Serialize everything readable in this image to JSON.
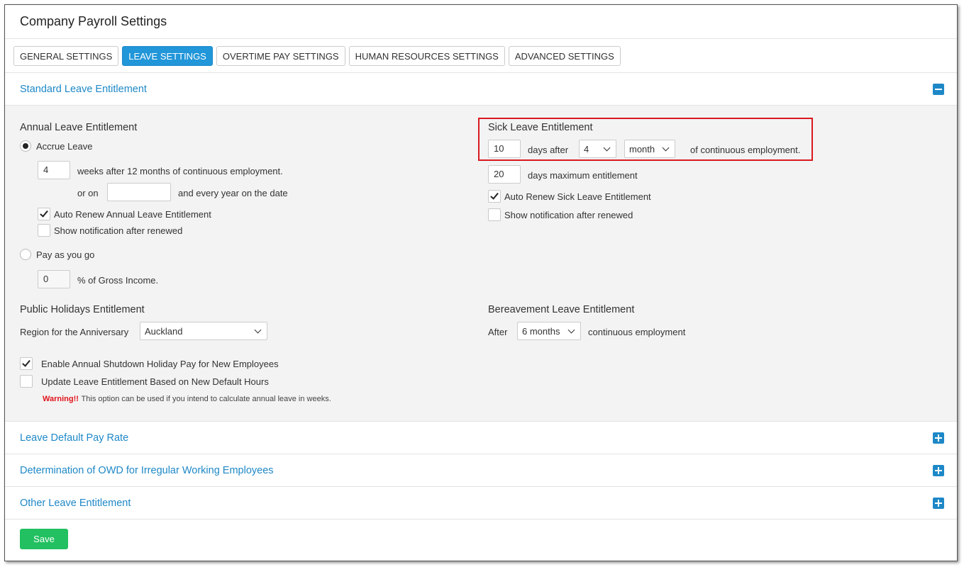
{
  "page_title": "Company Payroll Settings",
  "tabs": [
    {
      "label": "GENERAL SETTINGS",
      "active": false
    },
    {
      "label": "LEAVE SETTINGS",
      "active": true
    },
    {
      "label": "OVERTIME PAY SETTINGS",
      "active": false
    },
    {
      "label": "HUMAN RESOURCES SETTINGS",
      "active": false
    },
    {
      "label": "ADVANCED SETTINGS",
      "active": false
    }
  ],
  "standard": {
    "title": "Standard Leave Entitlement",
    "annual": {
      "heading": "Annual Leave Entitlement",
      "accrue_label": "Accrue Leave",
      "weeks_value": "4",
      "weeks_text": "weeks after 12 months of continuous employment.",
      "or_on": "or on",
      "date_value": "",
      "every_year": "and every year on the date",
      "auto_renew": "Auto Renew Annual Leave Entitlement",
      "auto_renew_checked": true,
      "show_notification": "Show notification after renewed",
      "show_notification_checked": false,
      "payg_label": "Pay as you go",
      "payg_value": "0",
      "payg_text": "% of Gross Income."
    },
    "sick": {
      "heading": "Sick Leave Entitlement",
      "days_value": "10",
      "days_after": "days after",
      "count_value": "4",
      "unit_value": "month",
      "continuous": "of continuous employment.",
      "max_value": "20",
      "max_text": "days maximum entitlement",
      "auto_renew": "Auto Renew Sick Leave Entitlement",
      "auto_renew_checked": true,
      "show_notification": "Show notification after renewed",
      "show_notification_checked": false
    },
    "public": {
      "heading": "Public Holidays Entitlement",
      "region_label": "Region for the Anniversary",
      "region_value": "Auckland"
    },
    "bereavement": {
      "heading": "Bereavement Leave Entitlement",
      "after": "After",
      "period_value": "6 months",
      "continuous": "continuous employment"
    },
    "shutdown_label": "Enable Annual Shutdown Holiday Pay for New Employees",
    "shutdown_checked": true,
    "update_label": "Update Leave Entitlement Based on New Default Hours",
    "update_checked": false,
    "warning_label": "Warning!!",
    "warning_text": "This option can be used if you intend to calculate annual leave in weeks."
  },
  "collapsed_sections": [
    {
      "title": "Leave Default Pay Rate"
    },
    {
      "title": "Determination of OWD for Irregular Working Employees"
    },
    {
      "title": "Other Leave Entitlement"
    }
  ],
  "save_label": "Save",
  "accent_color": "#1e88c7",
  "save_color": "#22c060"
}
